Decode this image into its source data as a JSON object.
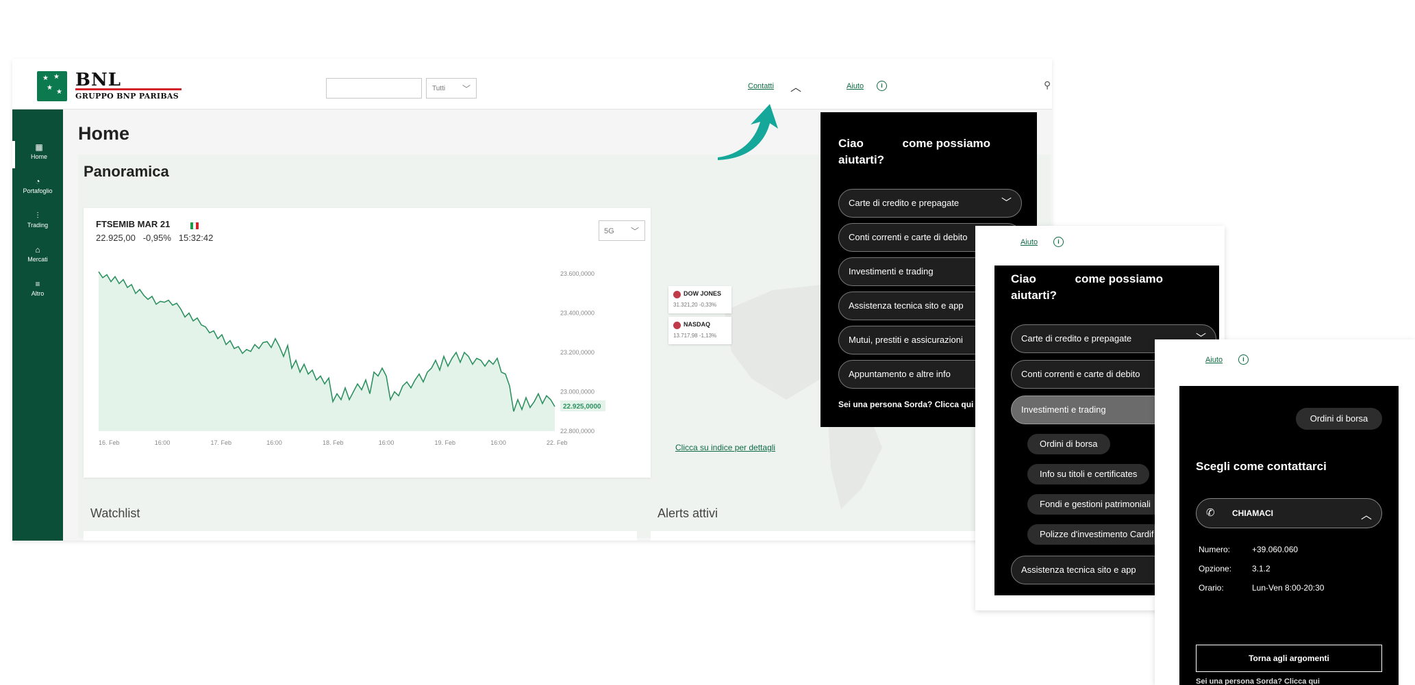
{
  "logo": {
    "brand": "BNL",
    "group": "GRUPPO BNP PARIBAS"
  },
  "header": {
    "search_value": "",
    "filter_value": "Tutti",
    "contatti": "Contatti",
    "aiuto": "Aiuto"
  },
  "sidebar": {
    "items": [
      {
        "label": "Home",
        "icon": "home-grid-icon"
      },
      {
        "label": "Portafoglio",
        "icon": "pie-chart-icon"
      },
      {
        "label": "Trading",
        "icon": "sliders-icon"
      },
      {
        "label": "Mercati",
        "icon": "bank-icon"
      },
      {
        "label": "Altro",
        "icon": "menu-icon"
      }
    ]
  },
  "page": {
    "title": "Home",
    "section": "Panoramica"
  },
  "chart": {
    "symbol": "FTSEMIB MAR 21",
    "price": "22.925,00",
    "change": "-0,95%",
    "time": "15:32:42",
    "period": "5G",
    "current_label": "22.925,0000"
  },
  "chart_data": {
    "type": "area",
    "x_ticks": [
      "16. Feb",
      "16:00",
      "17. Feb",
      "16:00",
      "18. Feb",
      "16:00",
      "19. Feb",
      "16:00",
      "22. Feb"
    ],
    "y_ticks": [
      "23.600,0000",
      "23.400,0000",
      "23.200,0000",
      "23.000,0000",
      "22.800,0000"
    ],
    "ylim": [
      22800,
      23600
    ],
    "values": [
      23610,
      23580,
      23595,
      23560,
      23585,
      23550,
      23570,
      23530,
      23545,
      23500,
      23520,
      23490,
      23470,
      23485,
      23445,
      23460,
      23455,
      23465,
      23440,
      23450,
      23420,
      23380,
      23400,
      23360,
      23375,
      23340,
      23330,
      23300,
      23310,
      23270,
      23290,
      23240,
      23260,
      23220,
      23230,
      23195,
      23215,
      23205,
      23240,
      23220,
      23250,
      23255,
      23225,
      23270,
      23230,
      23180,
      23235,
      23120,
      23160,
      23100,
      23140,
      23090,
      23110,
      23060,
      23080,
      23040,
      23070,
      22950,
      22990,
      22960,
      23020,
      22960,
      23000,
      23040,
      23010,
      23060,
      22990,
      23100,
      23080,
      23120,
      23080,
      22960,
      23000,
      22980,
      23030,
      23050,
      23020,
      23060,
      23090,
      23050,
      23100,
      23120,
      23160,
      23110,
      23180,
      23130,
      23170,
      23200,
      23150,
      23200,
      23180,
      23140,
      23170,
      23160,
      23130,
      23160,
      23140,
      23170,
      23100,
      23090,
      23030,
      22900,
      22960,
      22910,
      22970,
      22920,
      22950,
      22990,
      22940,
      22980,
      22960,
      22925
    ],
    "grid": false,
    "color": "#2e9160"
  },
  "map": {
    "indices": [
      {
        "name": "DOW JONES",
        "value": "31.321,20  -0,33%"
      },
      {
        "name": "NASDAQ",
        "value": "13.717,98  -1,13%"
      }
    ],
    "link": "Clicca su indice per dettagli"
  },
  "bottom": {
    "watchlist": "Watchlist",
    "alerts": "Alerts attivi"
  },
  "help1": {
    "greet_a": "Ciao",
    "greet_b": "come possiamo",
    "greet_c": "aiutarti?",
    "topics": [
      "Carte di credito e prepagate",
      "Conti correnti e carte di debito",
      "Investimenti e trading",
      "Assistenza tecnica sito e app",
      "Mutui, prestiti e assicurazioni",
      "Appuntamento e altre info"
    ],
    "sorda": "Sei una persona Sorda? Clicca qui"
  },
  "help2": {
    "aiuto": "Aiuto",
    "greet_a": "Ciao",
    "greet_b": "come possiamo",
    "greet_c": "aiutarti?",
    "topics": [
      "Carte di credito e prepagate",
      "Conti correnti e carte di debito",
      "Investimenti e trading",
      "Assistenza tecnica sito e app"
    ],
    "subtopics": [
      "Ordini di borsa",
      "Info su titoli e certificates",
      "Fondi e gestioni patrimoniali",
      "Polizze d'investimento Cardif"
    ]
  },
  "help3": {
    "aiuto": "Aiuto",
    "chip": "Ordini di borsa",
    "title": "Scegli come contattarci",
    "chiamaci": "CHIAMACI",
    "rows": [
      {
        "k": "Numero:",
        "v": "+39.060.060"
      },
      {
        "k": "Opzione:",
        "v": "3.1.2"
      },
      {
        "k": "Orario:",
        "v": "Lun-Ven 8:00-20:30"
      }
    ],
    "back": "Torna agli argomenti",
    "cut": "Sei una persona Sorda? Clicca qui"
  },
  "colors": {
    "brand_green": "#0b4f38",
    "accent_teal": "#16a79b",
    "link_green": "#0c6a43"
  }
}
